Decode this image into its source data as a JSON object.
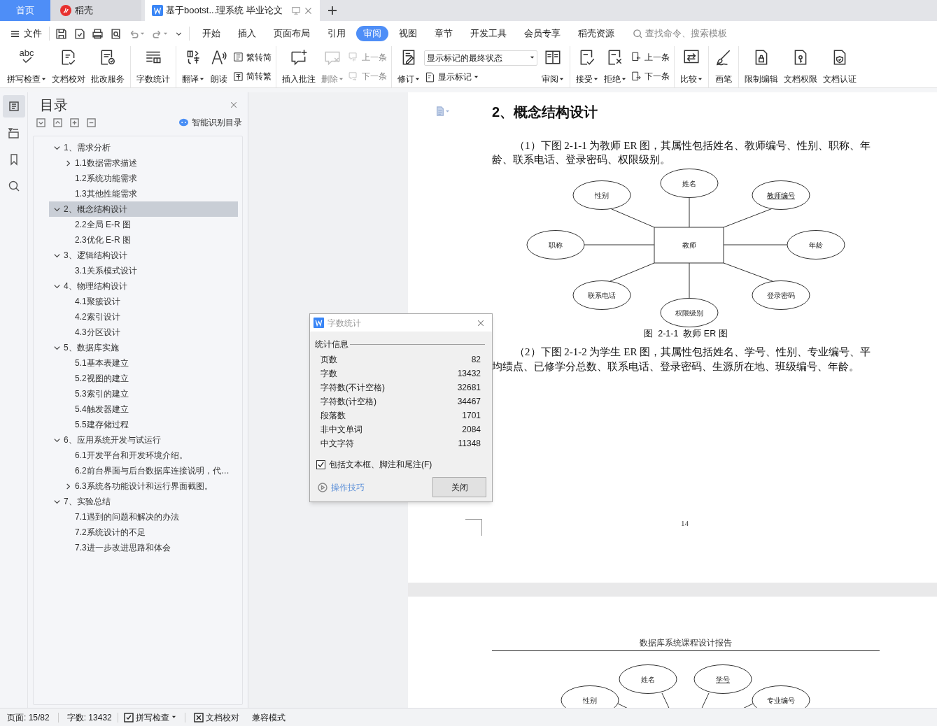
{
  "tabs": [
    {
      "label": "首页",
      "kind": "home",
      "selected": false
    },
    {
      "label": "稻壳",
      "kind": "docer",
      "selected": false
    },
    {
      "label": "基于bootst...理系统 毕业论文",
      "kind": "doc",
      "selected": true
    }
  ],
  "menu": {
    "file": "文件",
    "tabs": [
      {
        "label": "开始",
        "selected": false
      },
      {
        "label": "插入",
        "selected": false
      },
      {
        "label": "页面布局",
        "selected": false
      },
      {
        "label": "引用",
        "selected": false
      },
      {
        "label": "审阅",
        "selected": true
      },
      {
        "label": "视图",
        "selected": false
      },
      {
        "label": "章节",
        "selected": false
      },
      {
        "label": "开发工具",
        "selected": false
      },
      {
        "label": "会员专享",
        "selected": false
      },
      {
        "label": "稻壳资源",
        "selected": false
      }
    ],
    "search_placeholder": "查找命令、搜索模板"
  },
  "ribbon": [
    {
      "items": [
        {
          "kind": "large",
          "label": "拼写检查",
          "icon_text": "abc",
          "dropdown": true,
          "disabled": false
        },
        {
          "kind": "large",
          "label": "文档校对",
          "dropdown": false,
          "disabled": false
        },
        {
          "kind": "large",
          "label": "批改服务",
          "dropdown": false,
          "disabled": false
        }
      ]
    },
    {
      "items": [
        {
          "kind": "large",
          "label": "字数统计",
          "dropdown": false,
          "disabled": false
        }
      ]
    },
    {
      "items": [
        {
          "kind": "large",
          "label": "翻译",
          "dropdown": true,
          "disabled": false
        },
        {
          "kind": "large",
          "label": "朗读",
          "dropdown": false,
          "disabled": false
        },
        {
          "kind": "stack",
          "items": [
            {
              "kind": "small",
              "label": "繁转简",
              "dropdown": false,
              "disabled": false
            },
            {
              "kind": "small",
              "label": "简转繁",
              "dropdown": false,
              "disabled": false
            }
          ]
        }
      ]
    },
    {
      "items": [
        {
          "kind": "large",
          "label": "插入批注",
          "dropdown": false,
          "disabled": false
        },
        {
          "kind": "large",
          "label": "删除",
          "dropdown": true,
          "disabled": true
        },
        {
          "kind": "stack",
          "items": [
            {
              "kind": "small",
              "label": "上一条",
              "dropdown": false,
              "disabled": true
            },
            {
              "kind": "small",
              "label": "下一条",
              "dropdown": false,
              "disabled": true
            }
          ]
        }
      ]
    },
    {
      "items": [
        {
          "kind": "large",
          "label": "修订",
          "dropdown": true,
          "disabled": false
        },
        {
          "kind": "stack",
          "items": [
            {
              "kind": "select",
              "label": "显示标记的最终状态",
              "dropdown": true
            },
            {
              "kind": "small",
              "label": "显示标记",
              "dropdown": true,
              "disabled": false
            }
          ]
        },
        {
          "kind": "large",
          "label": "审阅",
          "dropdown": true,
          "disabled": false
        }
      ]
    },
    {
      "items": [
        {
          "kind": "large",
          "label": "接受",
          "dropdown": true,
          "disabled": false
        },
        {
          "kind": "large",
          "label": "拒绝",
          "dropdown": true,
          "disabled": false
        },
        {
          "kind": "stack",
          "items": [
            {
              "kind": "small",
              "label": "上一条",
              "dropdown": false,
              "disabled": false
            },
            {
              "kind": "small",
              "label": "下一条",
              "dropdown": false,
              "disabled": false
            }
          ]
        }
      ]
    },
    {
      "items": [
        {
          "kind": "large",
          "label": "比较",
          "dropdown": true,
          "disabled": false
        }
      ]
    },
    {
      "items": [
        {
          "kind": "large",
          "label": "画笔",
          "dropdown": false,
          "disabled": false
        }
      ]
    },
    {
      "items": [
        {
          "kind": "large",
          "label": "限制编辑",
          "dropdown": false,
          "disabled": false
        },
        {
          "kind": "large",
          "label": "文档权限",
          "dropdown": false,
          "disabled": false
        },
        {
          "kind": "large",
          "label": "文档认证",
          "dropdown": false,
          "disabled": false
        }
      ]
    }
  ],
  "toc": {
    "title": "目录",
    "smart_button": "智能识别目录",
    "items": [
      {
        "label": "1、需求分析",
        "expanded": true,
        "selected": false,
        "children": [
          {
            "label": "1.1数据需求描述",
            "expanded": false,
            "selected": false
          },
          {
            "label": "1.2系统功能需求",
            "selected": false
          },
          {
            "label": "1.3其他性能需求",
            "selected": false
          }
        ]
      },
      {
        "label": "2、概念结构设计",
        "expanded": true,
        "selected": true,
        "children": [
          {
            "label": "2.2全局 E-R 图",
            "selected": false
          },
          {
            "label": "2.3优化 E-R 图",
            "selected": false
          }
        ]
      },
      {
        "label": "3、逻辑结构设计",
        "expanded": true,
        "selected": false,
        "children": [
          {
            "label": "3.1关系模式设计",
            "selected": false
          }
        ]
      },
      {
        "label": "4、物理结构设计",
        "expanded": true,
        "selected": false,
        "children": [
          {
            "label": "4.1聚簇设计",
            "selected": false
          },
          {
            "label": "4.2索引设计",
            "selected": false
          },
          {
            "label": "4.3分区设计",
            "selected": false
          }
        ]
      },
      {
        "label": "5、数据库实施",
        "expanded": true,
        "selected": false,
        "children": [
          {
            "label": "5.1基本表建立",
            "selected": false
          },
          {
            "label": "5.2视图的建立",
            "selected": false
          },
          {
            "label": "5.3索引的建立",
            "selected": false
          },
          {
            "label": "5.4触发器建立",
            "selected": false
          },
          {
            "label": "5.5建存储过程",
            "selected": false
          }
        ]
      },
      {
        "label": "6、应用系统开发与试运行",
        "expanded": true,
        "selected": false,
        "children": [
          {
            "label": "6.1开发平台和开发环境介绍。",
            "selected": false
          },
          {
            "label": "6.2前台界面与后台数据库连接说明，代…",
            "selected": false
          },
          {
            "label": "6.3系统各功能设计和运行界面截图。",
            "expanded": false,
            "selected": false
          }
        ]
      },
      {
        "label": "7、实验总结",
        "expanded": true,
        "selected": false,
        "children": [
          {
            "label": "7.1遇到的问题和解决的办法",
            "selected": false
          },
          {
            "label": "7.2系统设计的不足",
            "selected": false
          },
          {
            "label": "7.3进一步改进思路和体会",
            "selected": false
          }
        ]
      }
    ]
  },
  "document": {
    "heading": "2、概念结构设计",
    "paragraph_1": "（1）下图 2-1-1 为教师 ER 图，其属性包括姓名、教师编号、性别、职称、年龄、联系电话、登录密码、权限级别。",
    "er_diagram": {
      "entity": "教师",
      "attributes": [
        {
          "label": "性别",
          "key": false
        },
        {
          "label": "姓名",
          "key": false
        },
        {
          "label": "教师编号",
          "key": true
        },
        {
          "label": "职称",
          "key": false
        },
        {
          "label": "年龄",
          "key": false
        },
        {
          "label": "联系电话",
          "key": false
        },
        {
          "label": "权限级别",
          "key": false
        },
        {
          "label": "登录密码",
          "key": false
        }
      ]
    },
    "caption": "图  2-1-1  教师 ER 图",
    "paragraph_2": "（2）下图 2-1-2 为学生 ER 图，其属性包括姓名、学号、性别、专业编号、平均绩点、已修学分总数、联系电话、登录密码、生源所在地、班级编号、年龄。",
    "page_number": "14",
    "next_page_header": "数据库系统课程设计报告",
    "next_page_attributes": [
      {
        "label": "姓名",
        "key": false
      },
      {
        "label": "学号",
        "key": true
      },
      {
        "label": "性别",
        "key": false
      },
      {
        "label": "专业编号",
        "key": false
      }
    ]
  },
  "dialog": {
    "title": "字数统计",
    "section": "统计信息",
    "rows": [
      {
        "label": "页数",
        "value": "82"
      },
      {
        "label": "字数",
        "value": "13432"
      },
      {
        "label": "字符数(不计空格)",
        "value": "32681"
      },
      {
        "label": "字符数(计空格)",
        "value": "34467"
      },
      {
        "label": "段落数",
        "value": "1701"
      },
      {
        "label": "非中文单词",
        "value": "2084"
      },
      {
        "label": "中文字符",
        "value": "11348"
      }
    ],
    "checkbox": {
      "label": "包括文本框、脚注和尾注(F)",
      "checked": true
    },
    "tips_link": "操作技巧",
    "close_button": "关闭"
  },
  "status_bar": {
    "page": "页面: 15/82",
    "words": "字数: 13432",
    "spell_check": "拼写检查",
    "proofread": "文档校对",
    "mode": "兼容模式"
  }
}
